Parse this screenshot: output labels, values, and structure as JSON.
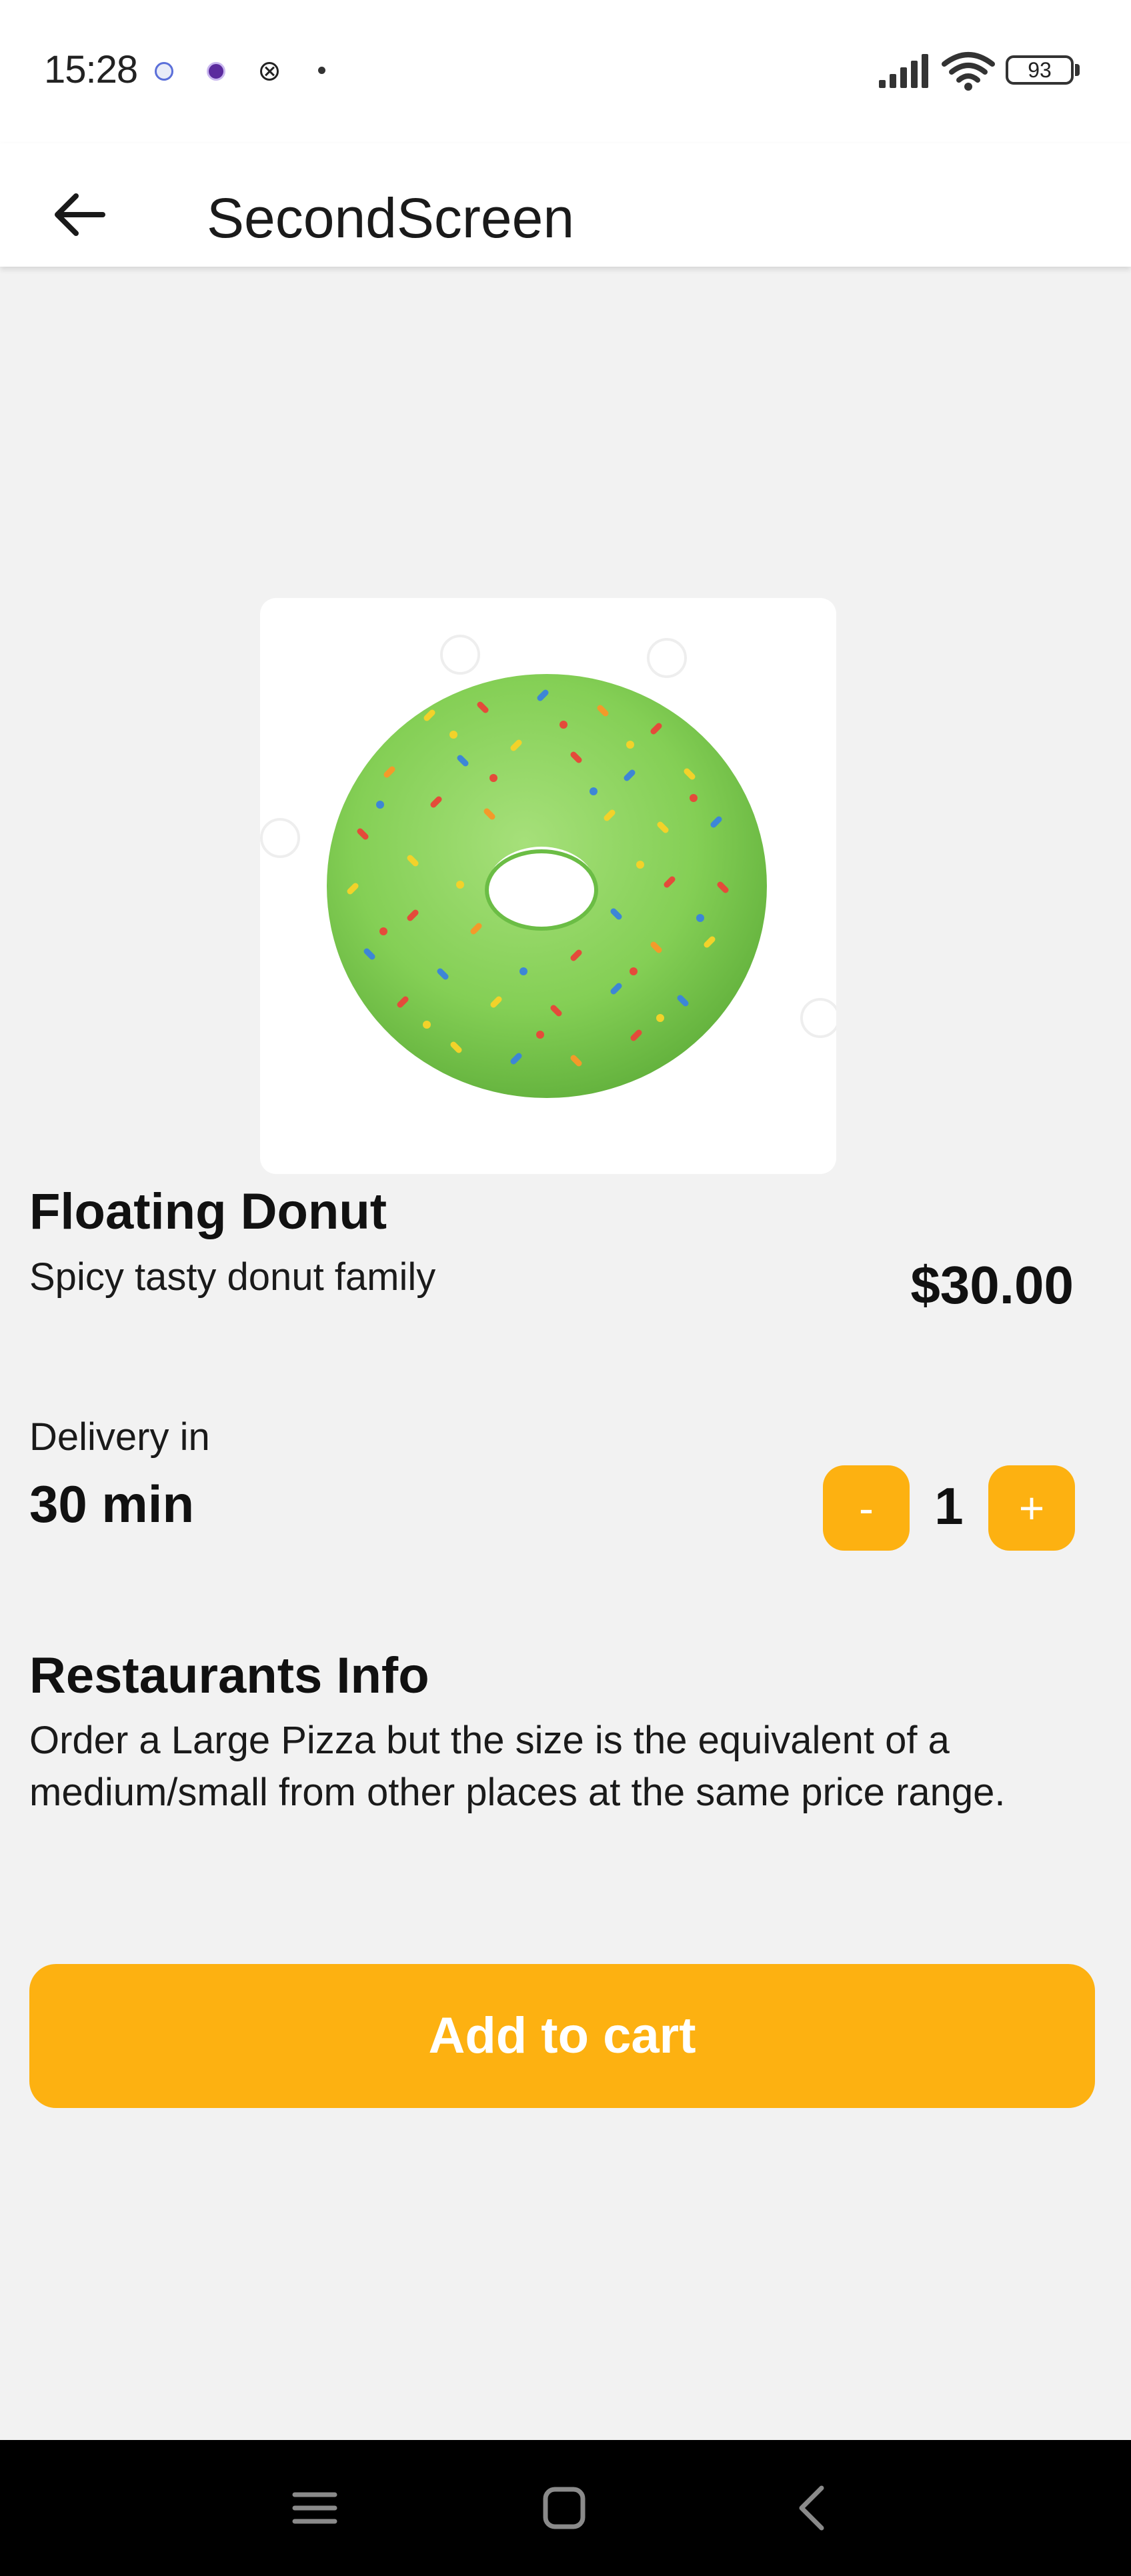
{
  "status_bar": {
    "time": "15:28",
    "battery_level": "93",
    "icons": [
      "notification-icon",
      "notification-icon",
      "notification-icon",
      "notification-dot",
      "signal-icon",
      "wifi-icon",
      "battery-icon"
    ]
  },
  "app_bar": {
    "title": "SecondScreen",
    "back_icon": "arrow-left-icon"
  },
  "product": {
    "image": "green-sprinkle-donut",
    "name": "Floating Donut",
    "description": "Spicy tasty donut family",
    "price": "$30.00"
  },
  "delivery": {
    "label": "Delivery in",
    "time": "30 min"
  },
  "quantity": {
    "minus_label": "-",
    "value": "1",
    "plus_label": "+"
  },
  "restaurant_info": {
    "heading": "Restaurants Info",
    "body": "Order a Large Pizza but the size is the equivalent of a medium/small from other places at the same price range."
  },
  "cart": {
    "button_label": "Add to cart"
  },
  "nav_bar": {
    "icons": [
      "menu-icon",
      "home-icon",
      "back-icon"
    ]
  },
  "colors": {
    "accent": "#fdb111",
    "background": "#f2f2f2",
    "surface": "#ffffff",
    "text": "#111111",
    "nav_background": "#000000"
  }
}
